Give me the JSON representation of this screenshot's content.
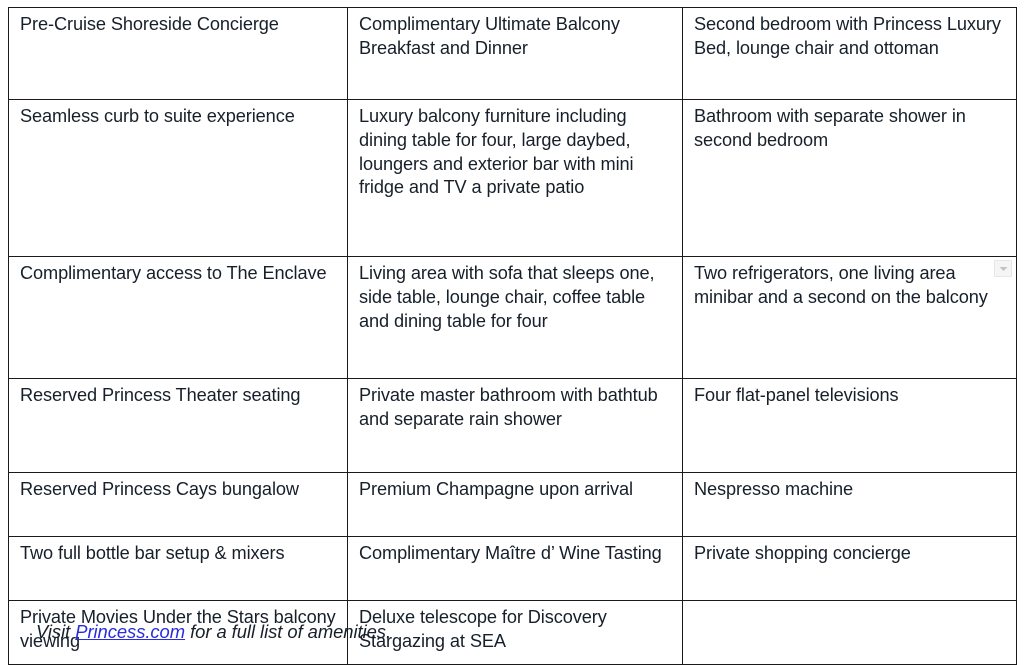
{
  "document": {
    "type": "amenities-table",
    "columns": 3,
    "rows": 7,
    "text_color": "#17202a",
    "border_color": "#1a1a1a",
    "link_color": "#2a2adf",
    "background": "#ffffff"
  },
  "table": {
    "rows": [
      {
        "col_a": "Pre-Cruise Shoreside Concierge",
        "col_b": "Complimentary Ultimate Balcony Breakfast and Dinner",
        "col_c": "Second bedroom with Princess Luxury Bed, lounge chair and ottoman"
      },
      {
        "col_a": "Seamless curb to suite experience",
        "col_b": "Luxury balcony furniture including dining table for four, large daybed, loungers and exterior bar with mini fridge and TV a private patio",
        "col_c": "Bathroom with separate shower in second bedroom"
      },
      {
        "col_a": "Complimentary access to The Enclave",
        "col_b": "Living area with sofa that sleeps one, side table, lounge chair, coffee table and dining table for four",
        "col_c": "Two refrigerators, one living area minibar and a second on the balcony"
      },
      {
        "col_a": "Reserved Princess Theater seating",
        "col_b": "Private master bathroom with bathtub and separate rain shower",
        "col_c": "Four flat-panel televisions"
      },
      {
        "col_a": "Reserved Princess Cays bungalow",
        "col_b": "Premium Champagne upon arrival",
        "col_c": "Nespresso machine"
      },
      {
        "col_a": "Two full bottle bar setup & mixers",
        "col_b": "Complimentary Maître d’ Wine Tasting",
        "col_c": "Private shopping concierge"
      },
      {
        "col_a": "Private Movies Under the Stars balcony viewing",
        "col_b": "Deluxe telescope for Discovery Stargazing at SEA",
        "col_c": ""
      }
    ]
  },
  "footer": {
    "lead": "Visit ",
    "link_label": "Princess.com",
    "tail": " for a full list of amenities."
  },
  "icons": {
    "dropdown_marker": "chevron-down-icon"
  }
}
